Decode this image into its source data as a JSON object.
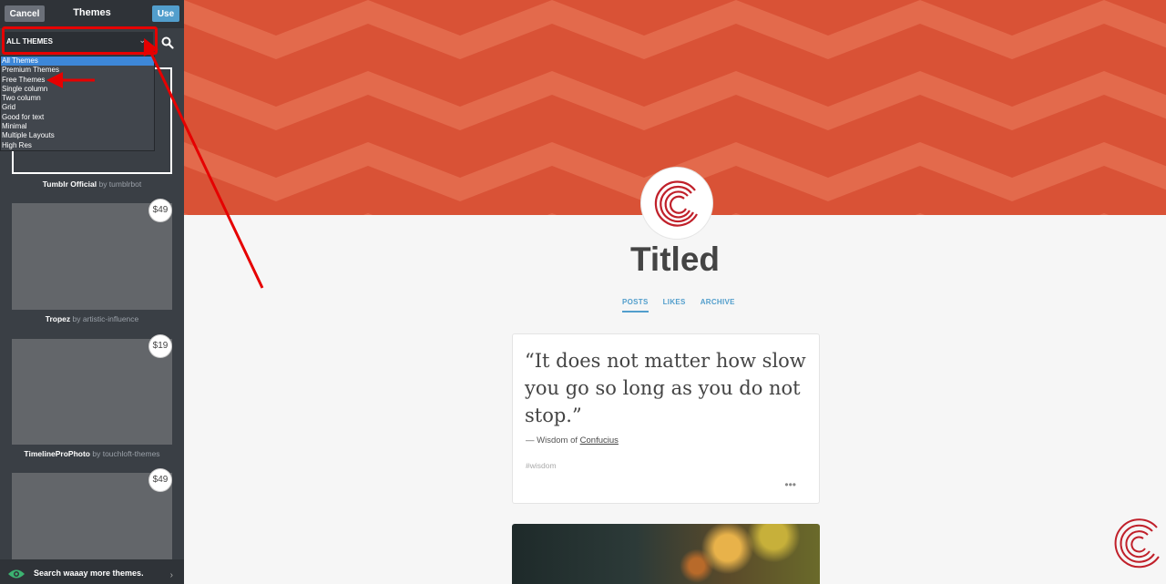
{
  "sidebar": {
    "cancel_label": "Cancel",
    "title": "Themes",
    "use_label": "Use",
    "filter_value": "ALL THEMES",
    "filter_options": [
      "All Themes",
      "Premium Themes",
      "Free Themes",
      "Single column",
      "Two column",
      "Grid",
      "Good for text",
      "Minimal",
      "Multiple Layouts",
      "High Res"
    ],
    "themes": [
      {
        "name": "Tumblr Official",
        "by": "by tumblrbot",
        "price": ""
      },
      {
        "name": "Tropez",
        "by": "by artistic-influence",
        "price": "$49"
      },
      {
        "name": "TimelineProPhoto",
        "by": "by touchloft-themes",
        "price": "$19"
      },
      {
        "name": "",
        "by": "",
        "price": "$49"
      }
    ],
    "bottom_text": "Search waaay more themes."
  },
  "blog": {
    "title": "Titled",
    "nav": [
      "POSTS",
      "LIKES",
      "ARCHIVE"
    ],
    "post": {
      "quote": "“It does not matter how slow you go so long as you do not stop.”",
      "source_prefix": "— Wisdom of",
      "source_link": "Confucius",
      "tag": "#wisdom",
      "more": "•••"
    }
  },
  "colors": {
    "hero": "#d95236",
    "accent": "#529ecc",
    "annotation": "#e60000"
  }
}
